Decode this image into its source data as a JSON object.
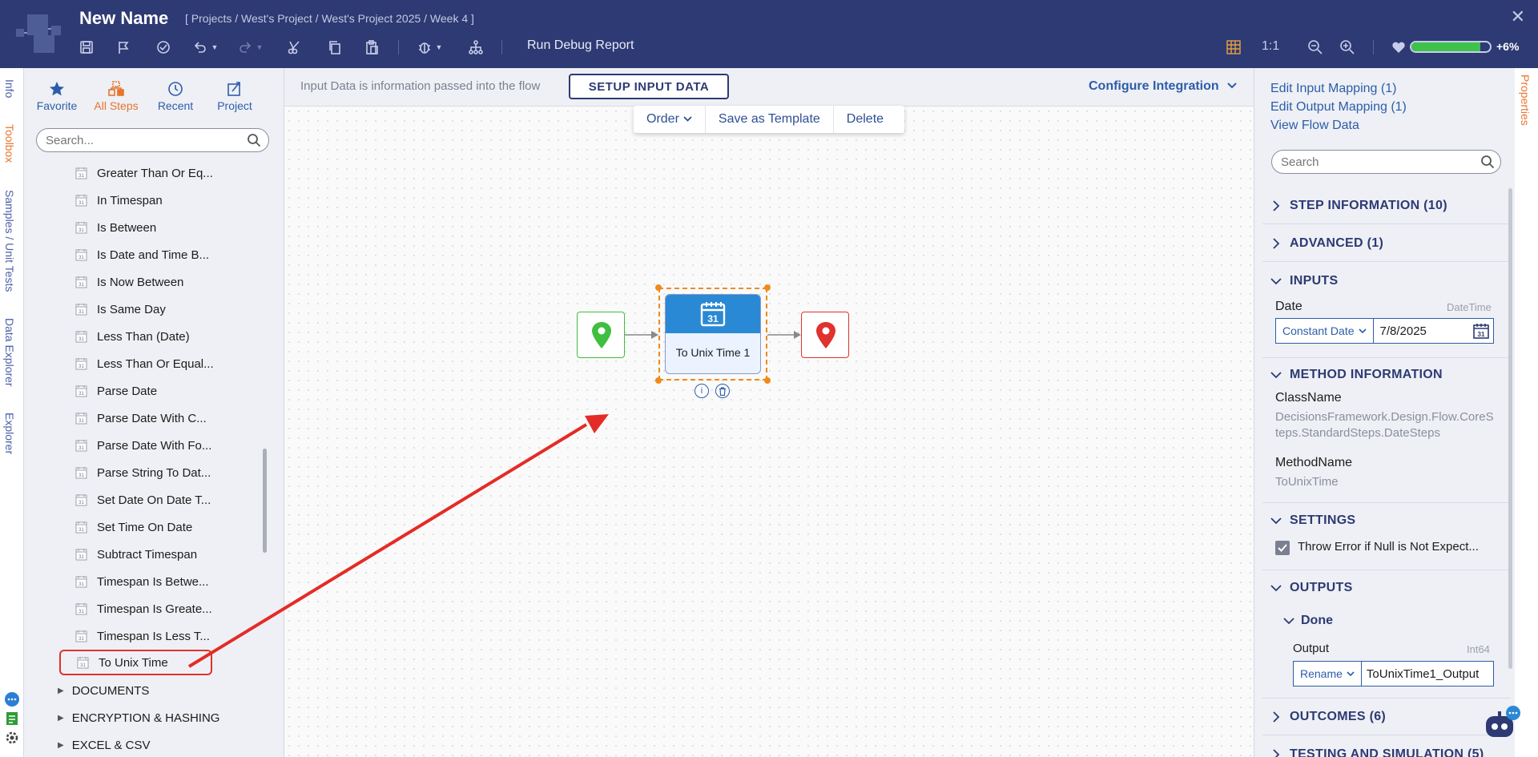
{
  "header": {
    "title": "New Name",
    "breadcrumb": "[ Projects / West's Project / West's Project 2025 / Week 4 ]",
    "run_debug_report": "Run Debug Report",
    "zoom_ratio": "1:1",
    "health_percent": "+6%",
    "health_level": 0.88
  },
  "left_tabs": [
    "Info",
    "Toolbox",
    "Samples / Unit Tests",
    "Data Explorer",
    "Explorer"
  ],
  "toolbox": {
    "tabs": [
      {
        "label": "Favorite",
        "icon": "star-icon"
      },
      {
        "label": "All Steps",
        "icon": "all-steps-icon"
      },
      {
        "label": "Recent",
        "icon": "clock-icon"
      },
      {
        "label": "Project",
        "icon": "project-icon"
      }
    ],
    "search_placeholder": "Search...",
    "steps": [
      "Greater Than Or Eq...",
      "In Timespan",
      "Is Between",
      "Is Date and Time B...",
      "Is Now Between",
      "Is Same Day",
      "Less Than (Date)",
      "Less Than Or Equal...",
      "Parse Date",
      "Parse Date With C...",
      "Parse Date With Fo...",
      "Parse String To Dat...",
      "Set Date On Date T...",
      "Set Time On Date",
      "Subtract Timespan",
      "Timespan Is Betwe...",
      "Timespan Is Greate...",
      "Timespan Is Less T...",
      "To Unix Time"
    ],
    "categories": [
      "DOCUMENTS",
      "ENCRYPTION & HASHING",
      "EXCEL & CSV"
    ]
  },
  "canvas": {
    "input_info": "Input Data is information passed into the flow",
    "setup_button": "SETUP INPUT DATA",
    "configure_integration": "Configure Integration",
    "floating_toolbar": {
      "order": "Order",
      "save_template": "Save as Template",
      "delete": "Delete"
    },
    "step_node": {
      "label": "To Unix Time 1",
      "calendar_day": "31"
    }
  },
  "properties": {
    "tab_label": "Properties",
    "links": [
      "Edit Input Mapping (1)",
      "Edit Output Mapping (1)",
      "View Flow Data"
    ],
    "search_placeholder": "Search",
    "sections": {
      "step_information": "STEP INFORMATION (10)",
      "advanced": "ADVANCED (1)",
      "inputs": "INPUTS",
      "method_information": "METHOD INFORMATION",
      "settings": "SETTINGS",
      "outputs": "OUTPUTS",
      "outcomes": "OUTCOMES (6)",
      "testing": "TESTING AND SIMULATION (5)"
    },
    "inputs": {
      "date_label": "Date",
      "date_type": "DateTime",
      "date_mode": "Constant Date",
      "date_value": "7/8/2025"
    },
    "method": {
      "classname_label": "ClassName",
      "classname_value": "DecisionsFramework.Design.Flow.CoreSteps.StandardSteps.DateSteps",
      "methodname_label": "MethodName",
      "methodname_value": "ToUnixTime"
    },
    "settings": {
      "throw_error_label": "Throw Error if Null is Not Expect...",
      "throw_error_checked": true
    },
    "outputs": {
      "done_label": "Done",
      "output_label": "Output",
      "output_type": "Int64",
      "output_mode": "Rename",
      "output_value": "ToUnixTime1_Output"
    }
  }
}
